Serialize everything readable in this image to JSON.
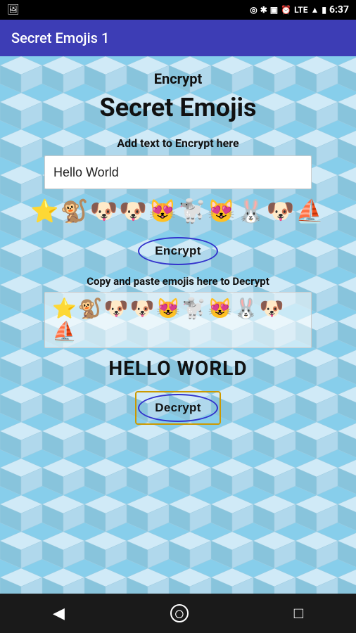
{
  "status_bar": {
    "time": "6:37",
    "lte_label": "LTE"
  },
  "app_bar": {
    "title": "Secret Emojis 1"
  },
  "main": {
    "encrypt_heading": "Encrypt",
    "app_title": "Secret Emojis",
    "add_text_label": "Add text to Encrypt here",
    "input_value": "Hello World",
    "input_placeholder": "Hello World",
    "emoji_output": "⭐🐒🐶🐶😻🐩😻🐰🐶⛵",
    "encrypt_button_label": "Encrypt",
    "decrypt_paste_label": "Copy and paste emojis here to Decrypt",
    "emoji_paste_value": "⭐🐒🐶🐶😻🐩😻🐰🐶⛵",
    "decrypted_output": "HELLO WORLD",
    "decrypt_button_label": "Decrypt"
  },
  "nav": {
    "back_icon": "◀",
    "home_icon": "○",
    "recents_icon": "□"
  }
}
